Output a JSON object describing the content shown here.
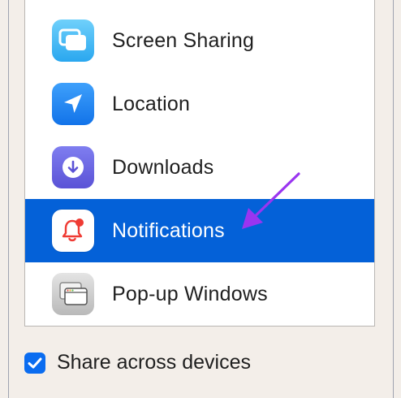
{
  "colors": {
    "selection": "#0461d8",
    "annotation_arrow": "#9a35f0",
    "checkbox": "#0a6cf0"
  },
  "list": {
    "items": [
      {
        "label": "Screen Sharing",
        "icon": "screen-sharing-icon",
        "selected": false
      },
      {
        "label": "Location",
        "icon": "location-arrow-icon",
        "selected": false
      },
      {
        "label": "Downloads",
        "icon": "download-icon",
        "selected": false
      },
      {
        "label": "Notifications",
        "icon": "notification-bell-icon",
        "selected": true
      },
      {
        "label": "Pop-up Windows",
        "icon": "popup-window-icon",
        "selected": false
      }
    ]
  },
  "footer": {
    "share_label": "Share across devices",
    "share_checked": true
  }
}
